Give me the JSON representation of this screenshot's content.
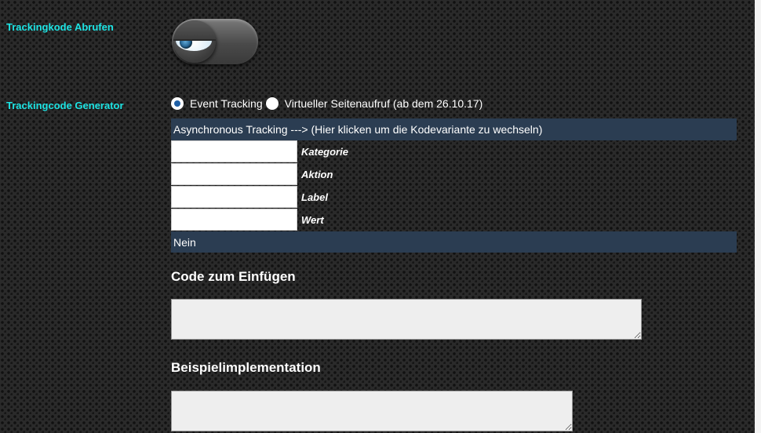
{
  "tracking_fetch": {
    "label": "Trackingkode Abrufen",
    "toggle_state": "off"
  },
  "generator": {
    "label": "Trackingcode Generator",
    "radio_options": [
      {
        "label": "Event Tracking",
        "checked": true
      },
      {
        "label": "Virtueller Seitenaufruf (ab dem 26.10.17)",
        "checked": false
      }
    ],
    "variant_bar": "Asynchronous Tracking ---> (Hier klicken um die Kodevariante zu wechseln)",
    "fields": [
      {
        "label": "Kategorie",
        "value": ""
      },
      {
        "label": "Aktion",
        "value": ""
      },
      {
        "label": "Label",
        "value": ""
      },
      {
        "label": "Wert",
        "value": ""
      }
    ],
    "non_interaction_value": "Nein"
  },
  "code_section": {
    "heading": "Code zum Einfügen",
    "value": ""
  },
  "example_section": {
    "heading": "Beispielimplementation",
    "value": ""
  },
  "colors": {
    "label_accent": "#1de4e4",
    "bar_background": "#2b3d52",
    "page_background": "#2a2a2a"
  }
}
